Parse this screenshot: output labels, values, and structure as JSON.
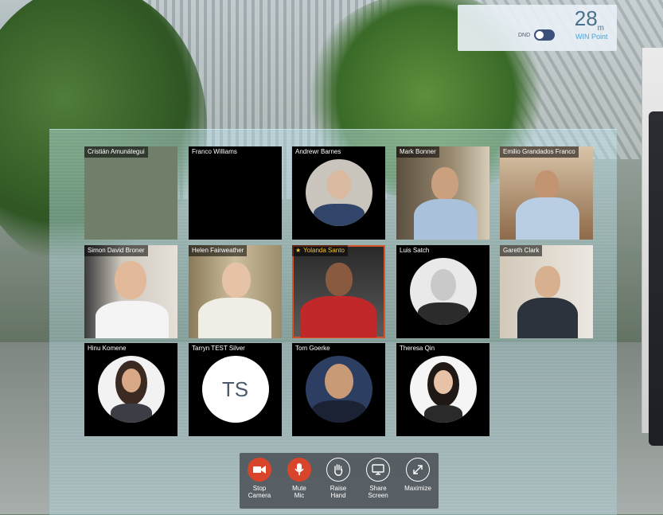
{
  "top_card": {
    "temperature": "28",
    "temperature_unit": "m",
    "dnd_label": "DND",
    "link_text": "WIN Point"
  },
  "participants": [
    {
      "name": "Cristián Amunátegui",
      "kind": "blank",
      "tile_color": "#6f7f69"
    },
    {
      "name": "Franco Williams",
      "kind": "blank",
      "tile_color": "#000000"
    },
    {
      "name": "Andrewr Barnes",
      "kind": "avatar"
    },
    {
      "name": "Mark Bonner",
      "kind": "video"
    },
    {
      "name": "Emilio Grandados Franco",
      "kind": "video"
    },
    {
      "name": "Simon David Broner",
      "kind": "video"
    },
    {
      "name": "Helen Fairweather",
      "kind": "video"
    },
    {
      "name": "Yolanda Santo",
      "kind": "video",
      "active_speaker": true
    },
    {
      "name": "Luis Satch",
      "kind": "avatar"
    },
    {
      "name": "Gareth Clark",
      "kind": "video"
    },
    {
      "name": "Hinu Komene",
      "kind": "avatar"
    },
    {
      "name": "Tarryn TEST Silver",
      "kind": "initials",
      "initials": "TS"
    },
    {
      "name": "Tom Goerke",
      "kind": "avatar"
    },
    {
      "name": "Theresa Qin",
      "kind": "avatar"
    }
  ],
  "toolbar": {
    "stop_camera": {
      "line1": "Stop",
      "line2": "Camera",
      "icon": "camera-icon"
    },
    "mute_mic": {
      "line1": "Mute",
      "line2": "Mic",
      "icon": "microphone-icon"
    },
    "raise_hand": {
      "line1": "Raise",
      "line2": "Hand",
      "icon": "hand-icon"
    },
    "share_screen": {
      "line1": "Share",
      "line2": "Screen",
      "icon": "monitor-icon"
    },
    "maximize": {
      "line1": "Maximize",
      "line2": "",
      "icon": "expand-icon"
    }
  },
  "colors": {
    "active_speaker_border": "#d8532b",
    "active_speaker_name": "#f4c430",
    "toolbar_active": "#d9452b",
    "link": "#4aa3d8"
  }
}
